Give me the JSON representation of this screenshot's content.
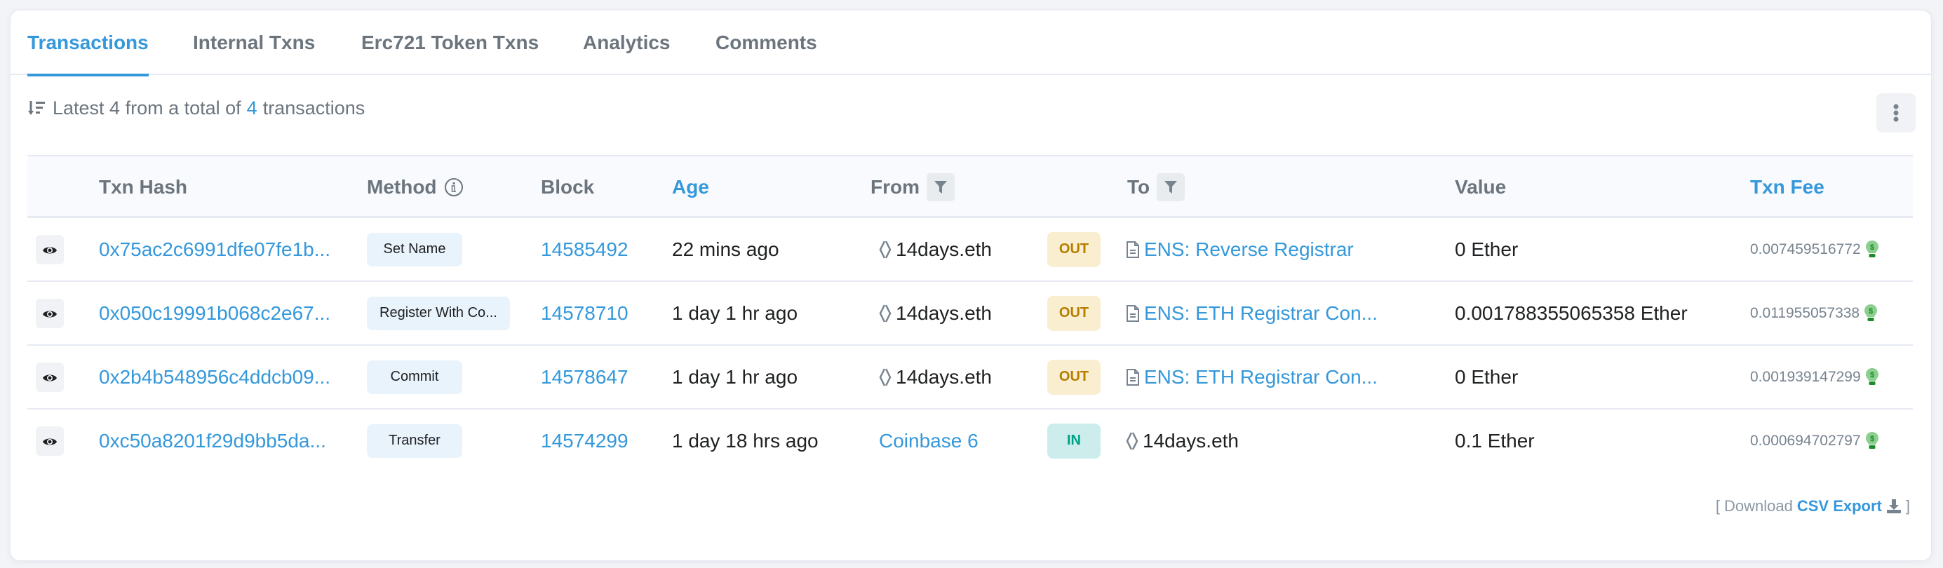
{
  "tabs": [
    {
      "label": "Transactions",
      "active": true
    },
    {
      "label": "Internal Txns",
      "active": false
    },
    {
      "label": "Erc721 Token Txns",
      "active": false
    },
    {
      "label": "Analytics",
      "active": false
    },
    {
      "label": "Comments",
      "active": false
    }
  ],
  "summary": {
    "prefix": "Latest 4 from a total of",
    "total": "4",
    "suffix": "transactions"
  },
  "table": {
    "headers": {
      "txn_hash": "Txn Hash",
      "method": "Method",
      "block": "Block",
      "age": "Age",
      "from": "From",
      "to": "To",
      "value": "Value",
      "txn_fee": "Txn Fee"
    },
    "rows": [
      {
        "hash": "0x75ac2c6991dfe07fe1b...",
        "method": "Set Name",
        "block": "14585492",
        "age": "22 mins ago",
        "from": "14days.eth",
        "from_type": "ens",
        "direction": "OUT",
        "to": "ENS: Reverse Registrar",
        "to_type": "contract",
        "value": "0 Ether",
        "fee": "0.007459516772"
      },
      {
        "hash": "0x050c19991b068c2e67...",
        "method": "Register With Co...",
        "block": "14578710",
        "age": "1 day 1 hr ago",
        "from": "14days.eth",
        "from_type": "ens",
        "direction": "OUT",
        "to": "ENS: ETH Registrar Con...",
        "to_type": "contract",
        "value": "0.001788355065358 Ether",
        "fee": "0.011955057338"
      },
      {
        "hash": "0x2b4b548956c4ddcb09...",
        "method": "Commit",
        "block": "14578647",
        "age": "1 day 1 hr ago",
        "from": "14days.eth",
        "from_type": "ens",
        "direction": "OUT",
        "to": "ENS: ETH Registrar Con...",
        "to_type": "contract",
        "value": "0 Ether",
        "fee": "0.001939147299"
      },
      {
        "hash": "0xc50a8201f29d9bb5da...",
        "method": "Transfer",
        "block": "14574299",
        "age": "1 day 18 hrs ago",
        "from": "Coinbase 6",
        "from_type": "link",
        "direction": "IN",
        "to": "14days.eth",
        "to_type": "ens",
        "value": "0.1 Ether",
        "fee": "0.000694702797"
      }
    ]
  },
  "footer": {
    "open_bracket": "[",
    "download_label": "Download",
    "csv_link": "CSV Export",
    "close_bracket": "]"
  },
  "colors": {
    "accent": "#3498db",
    "out_badge_bg": "#faeed0",
    "out_badge_text": "#b47d00",
    "in_badge_bg": "#cdeded",
    "in_badge_text": "#00a186",
    "method_badge_bg": "#e9f3fc"
  }
}
